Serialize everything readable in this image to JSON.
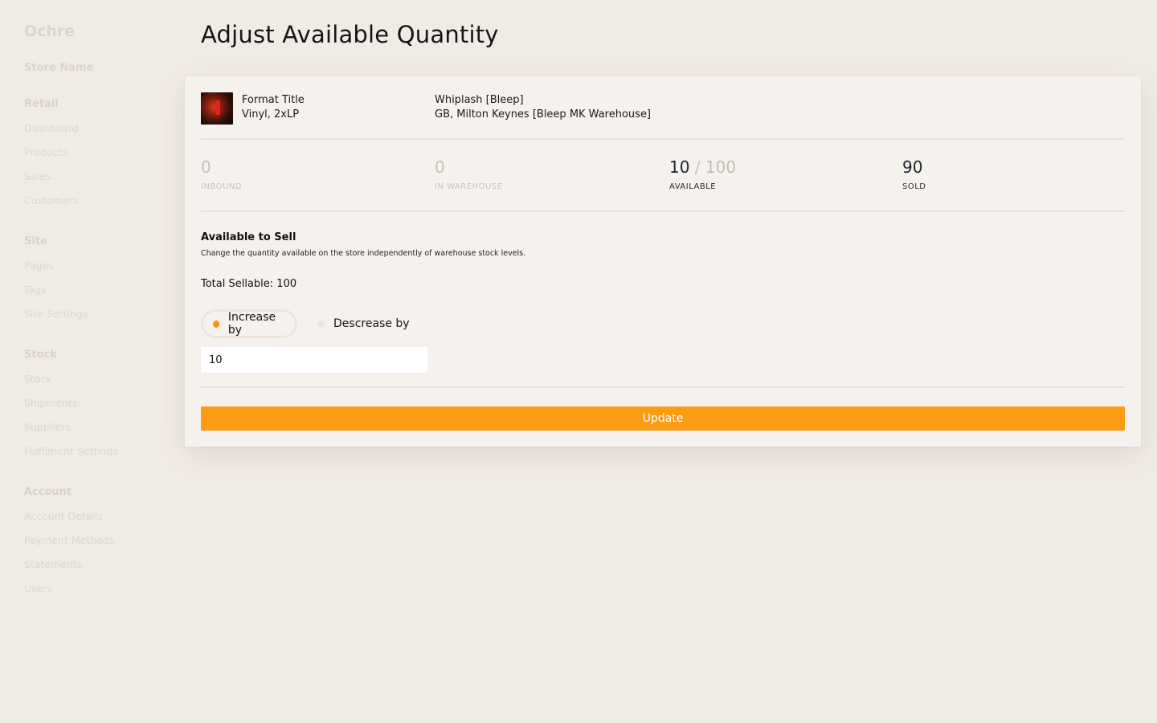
{
  "sidebar": {
    "brand": "Ochre",
    "store_name": "Store Name",
    "groups": [
      {
        "title": "Retail",
        "items": [
          "Dashboard",
          "Products",
          "Sales",
          "Customers"
        ]
      },
      {
        "title": "Site",
        "items": [
          "Pages",
          "Tags",
          "Site Settings"
        ]
      },
      {
        "title": "Stock",
        "items": [
          "Stock",
          "Shipments",
          "Suppliers",
          "Fulfilment Settings"
        ]
      },
      {
        "title": "Account",
        "items": [
          "Account Details",
          "Payment Methods",
          "Statements",
          "Users"
        ]
      }
    ]
  },
  "page": {
    "title": "Adjust Available Quantity"
  },
  "product": {
    "format_title": "Format Title",
    "format_sub": "Vinyl, 2xLP",
    "release_title": "Whiplash [Bleep]",
    "release_sub": "GB, Milton Keynes [Bleep MK Warehouse]"
  },
  "stats": {
    "inbound": {
      "value": "0",
      "label": "INBOUND"
    },
    "in_warehouse": {
      "value": "0",
      "label": "IN WAREHOUSE"
    },
    "available": {
      "value": "10",
      "sep": "/",
      "total": "100",
      "label": "AVAILABLE"
    },
    "sold": {
      "value": "90",
      "label": "SOLD"
    }
  },
  "section": {
    "title": "Available to Sell",
    "description": "Change the quantity available on the store independently of warehouse stock levels.",
    "total_sellable": "Total Sellable: 100"
  },
  "adjust": {
    "increase_label": "Increase by",
    "decrease_label": "Descrease by",
    "selected": "increase",
    "quantity_value": "10"
  },
  "actions": {
    "update_label": "Update"
  },
  "colors": {
    "accent": "#fa9c14",
    "background": "#f1ebe6",
    "card": "#f5f1ed"
  }
}
